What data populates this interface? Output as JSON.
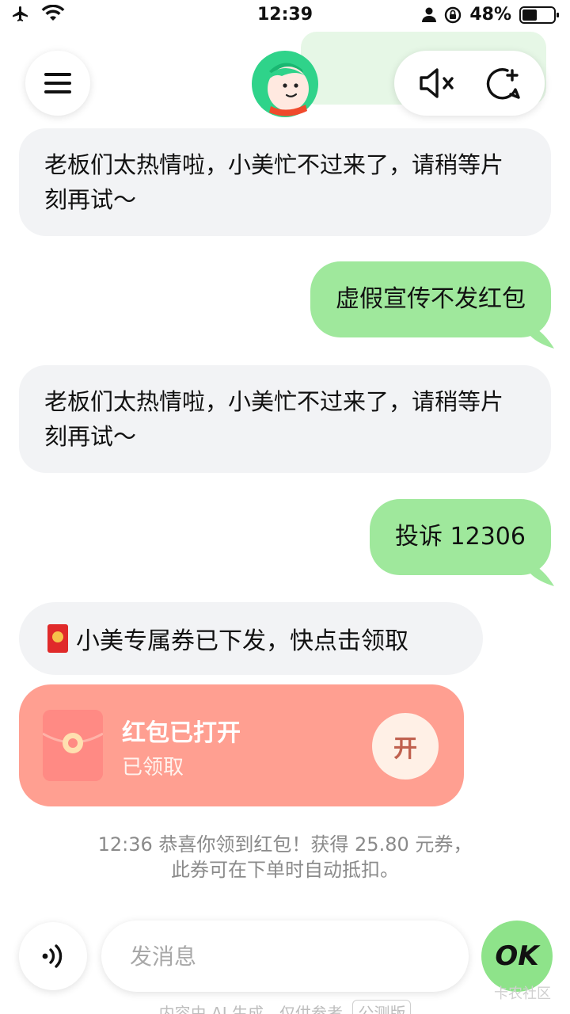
{
  "status_bar": {
    "time": "12:39",
    "battery_percent": "48%",
    "battery_level": 0.48
  },
  "header": {
    "menu_icon": "hamburger-icon",
    "avatar_icon": "assistant-avatar",
    "mute_icon": "speaker-mute-icon",
    "new_chat_icon": "new-chat-icon"
  },
  "messages": [
    {
      "role": "bot",
      "text": "老板们太热情啦，小美忙不过来了，请稍等片刻再试～"
    },
    {
      "role": "user",
      "text": "虚假宣传不发红包"
    },
    {
      "role": "bot",
      "text": "老板们太热情啦，小美忙不过来了，请稍等片刻再试～"
    },
    {
      "role": "user",
      "text": "投诉 12306"
    }
  ],
  "coupon_notice": {
    "text": "小美专属券已下发，快点击领取"
  },
  "red_packet": {
    "title": "红包已打开",
    "status": "已领取",
    "open_label": "开"
  },
  "system_note": {
    "line1": "12:36 恭喜你领到红包！获得 25.80 元券，",
    "line2": "此券可在下单时自动抵扣。"
  },
  "input_bar": {
    "placeholder": "发消息",
    "send_label": "OK"
  },
  "watermark": "卡农社区",
  "disclaimer": {
    "text": "内容由 AI 生成，仅供参考",
    "badge": "公测版"
  },
  "colors": {
    "user_bubble": "#9fe89c",
    "bot_bubble": "#f2f3f5",
    "red_packet": "#ff9f91",
    "ok_button": "#8ee38a"
  }
}
